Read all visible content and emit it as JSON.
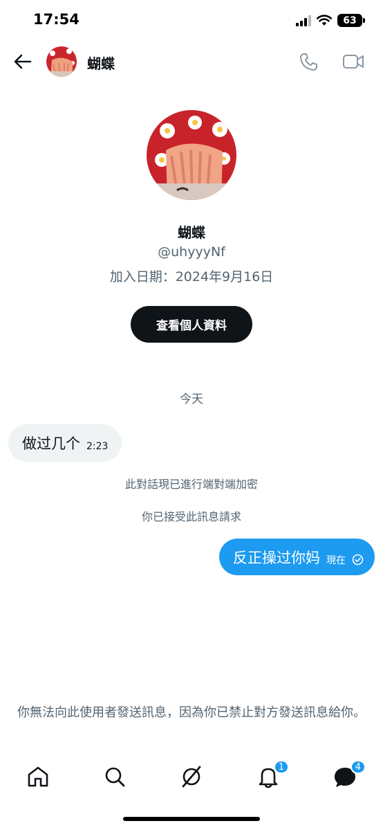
{
  "status_bar": {
    "time": "17:54",
    "battery": "63"
  },
  "header": {
    "name": "蝴蝶"
  },
  "profile": {
    "name": "蝴蝶",
    "handle": "@uhyyyNf",
    "joined": "加入日期：2024年9月16日",
    "view_profile_label": "查看個人資料"
  },
  "conversation": {
    "date_divider": "今天",
    "incoming": {
      "text": "做过几个",
      "time": "2:23"
    },
    "notices": [
      "此對話現已進行端對端加密",
      "你已接受此訊息請求"
    ],
    "outgoing": {
      "text": "反正操过你妈",
      "time": "現在"
    }
  },
  "blocked_notice": "你無法向此使用者發送訊息，因為你已禁止對方發送訊息給你。",
  "bottom_nav": {
    "notifications_badge": "1",
    "messages_badge": "4"
  },
  "colors": {
    "accent": "#1d9bf0",
    "text": "#0f1419",
    "secondary": "#536471",
    "bubble_incoming": "#eff3f4"
  }
}
